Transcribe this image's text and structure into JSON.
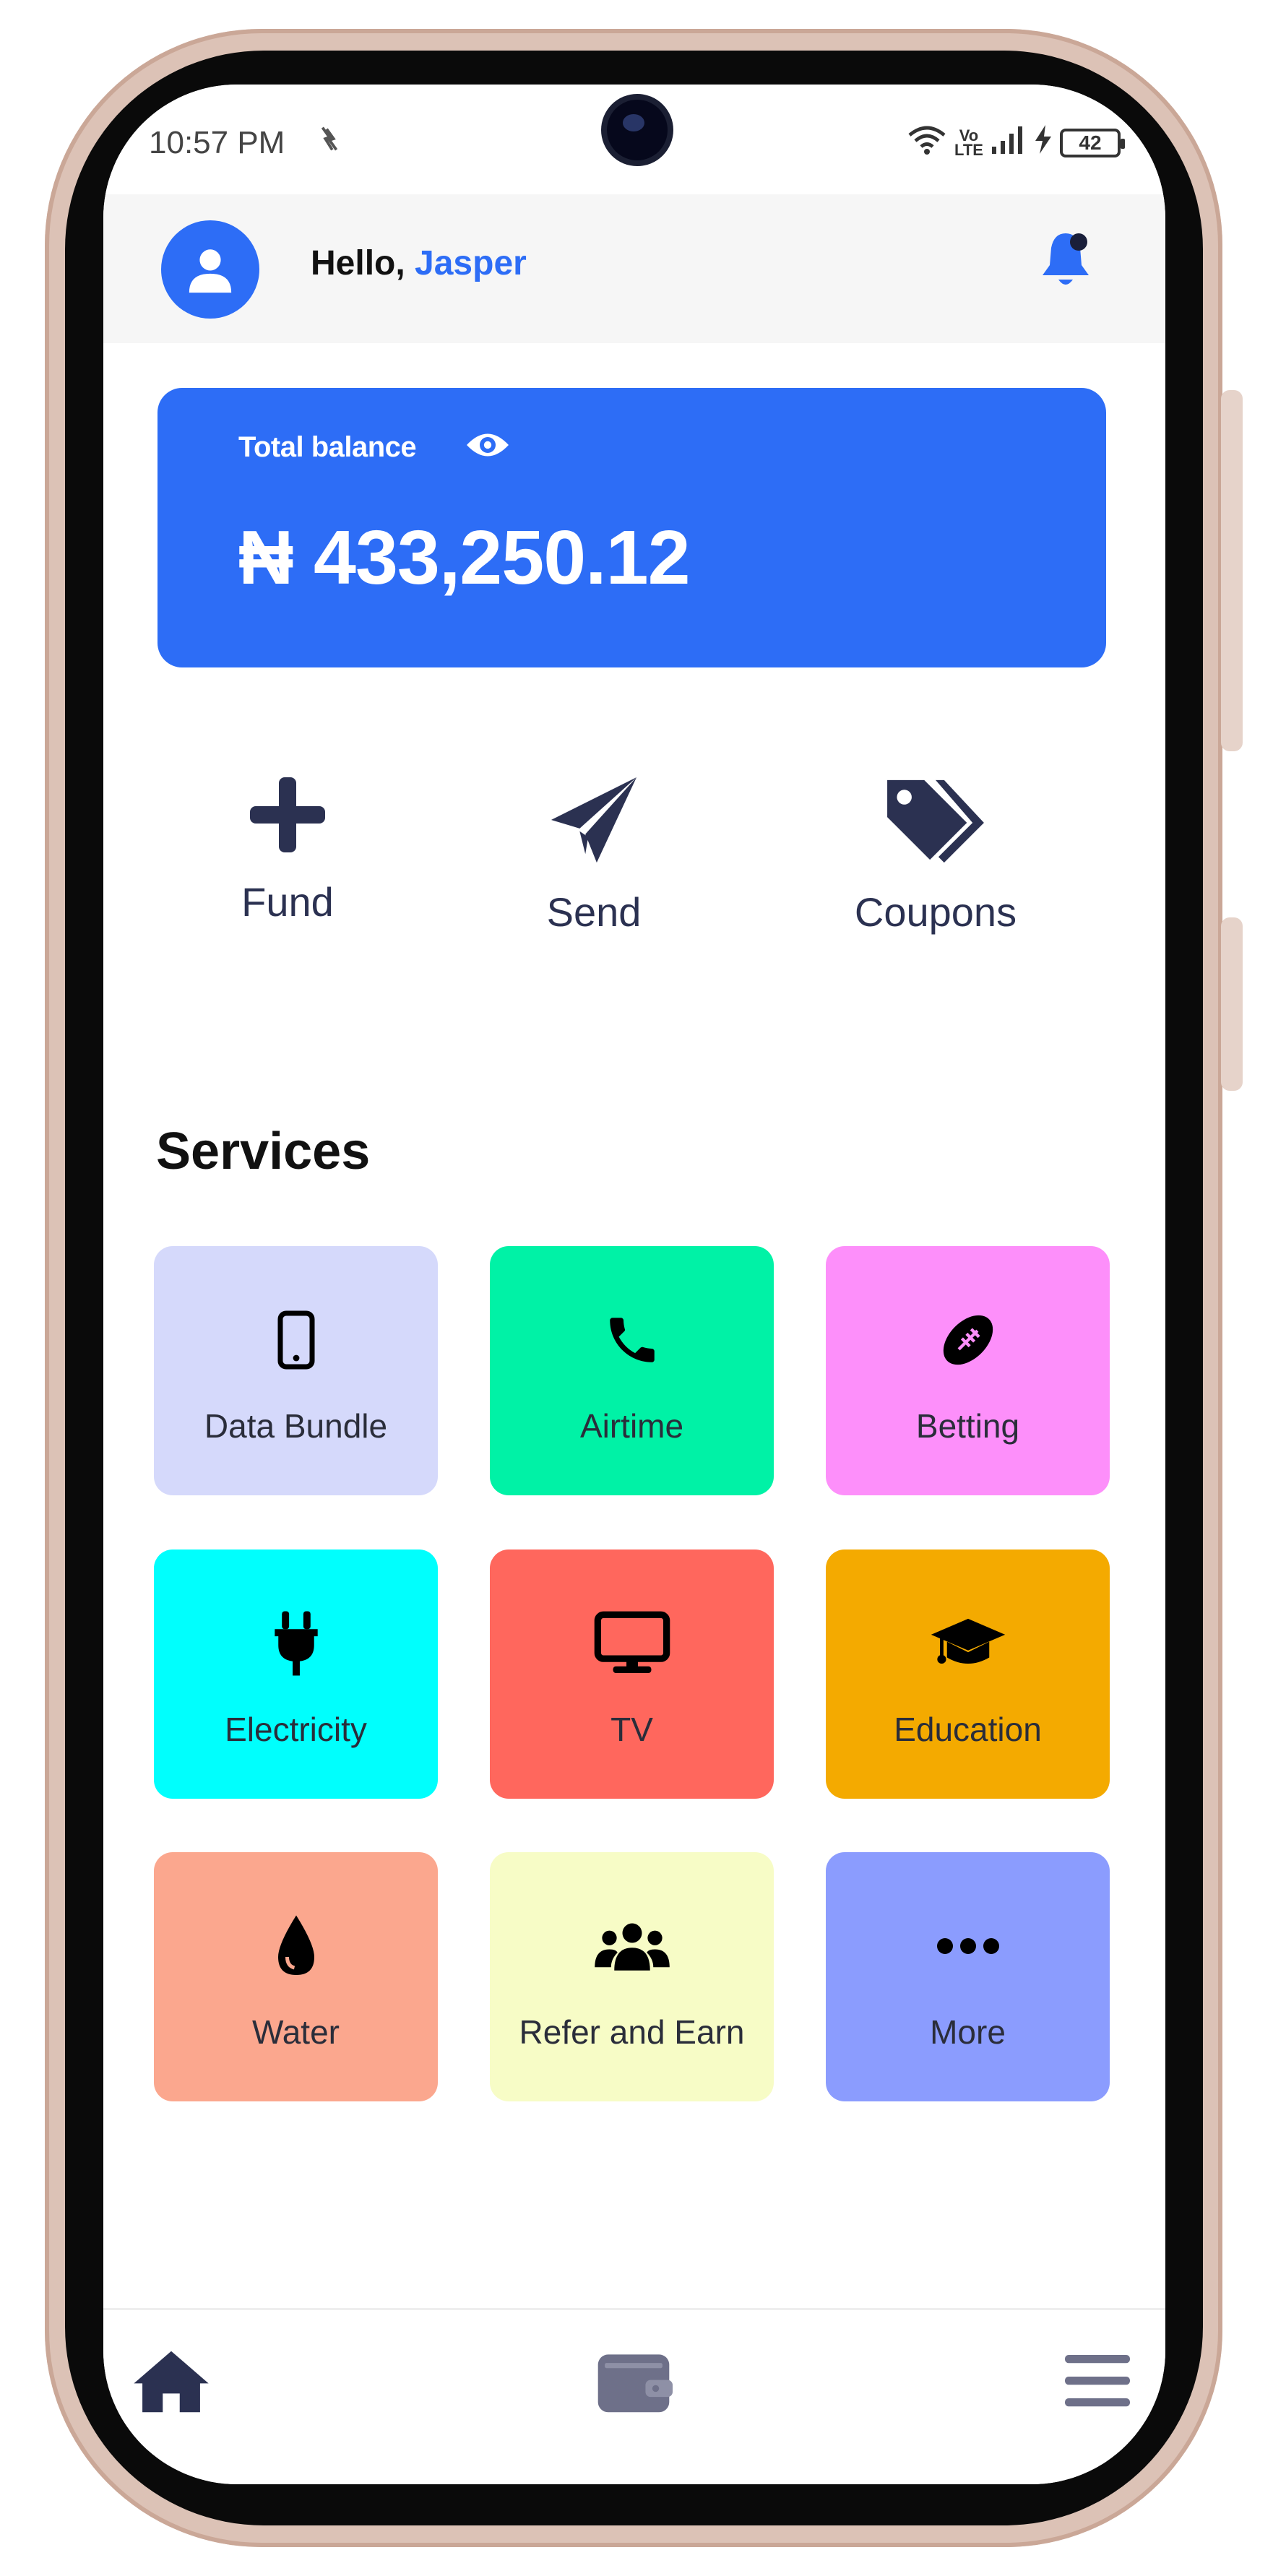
{
  "status_bar": {
    "time": "10:57 PM",
    "network_badge": "Vo LTE",
    "battery": "42"
  },
  "header": {
    "greeting": "Hello,",
    "user_name": "Jasper"
  },
  "balance": {
    "label": "Total balance",
    "amount": "₦ 433,250.12"
  },
  "actions": [
    {
      "label": "Fund",
      "icon": "plus-icon"
    },
    {
      "label": "Send",
      "icon": "paper-plane-icon"
    },
    {
      "label": "Coupons",
      "icon": "tags-icon"
    }
  ],
  "services": {
    "title": "Services",
    "items": [
      {
        "label": "Data Bundle",
        "icon": "mobile-phone-icon",
        "color": "#d5d9fb"
      },
      {
        "label": "Airtime",
        "icon": "phone-icon",
        "color": "#00f2a6"
      },
      {
        "label": "Betting",
        "icon": "football-icon",
        "color": "#fd8ffa"
      },
      {
        "label": "Electricity",
        "icon": "plug-icon",
        "color": "#00fffd"
      },
      {
        "label": "TV",
        "icon": "tv-icon",
        "color": "#ff675d"
      },
      {
        "label": "Education",
        "icon": "graduation-cap-icon",
        "color": "#f4aa00"
      },
      {
        "label": "Water",
        "icon": "water-drop-icon",
        "color": "#fba78e"
      },
      {
        "label": "Refer and Earn",
        "icon": "users-icon",
        "color": "#f7fcc6"
      },
      {
        "label": "More",
        "icon": "more-dots-icon",
        "color": "#8b9cfe"
      }
    ]
  },
  "bottom_nav": [
    {
      "icon": "home-icon"
    },
    {
      "icon": "wallet-icon"
    },
    {
      "icon": "menu-icon"
    }
  ],
  "colors": {
    "accent": "#2d6df6",
    "icon_dark": "#2b3151"
  }
}
